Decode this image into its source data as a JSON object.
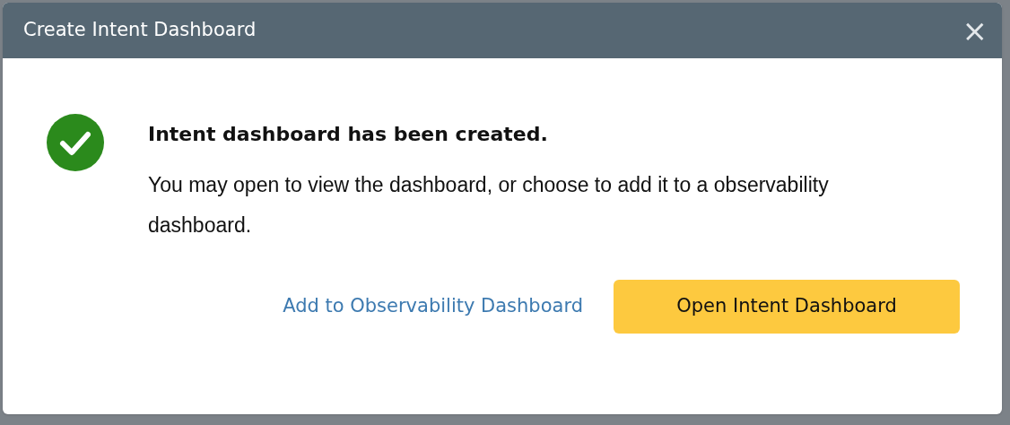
{
  "dialog": {
    "title": "Create Intent Dashboard",
    "close_label": "×",
    "heading": "Intent dashboard has been created.",
    "message": "You may open to view the dashboard, or choose to add it to a observability dashboard.",
    "buttons": [
      {
        "label": "Add to Observability Dashboard",
        "kind": "link"
      },
      {
        "label": "Open Intent Dashboard",
        "kind": "primary"
      }
    ]
  }
}
